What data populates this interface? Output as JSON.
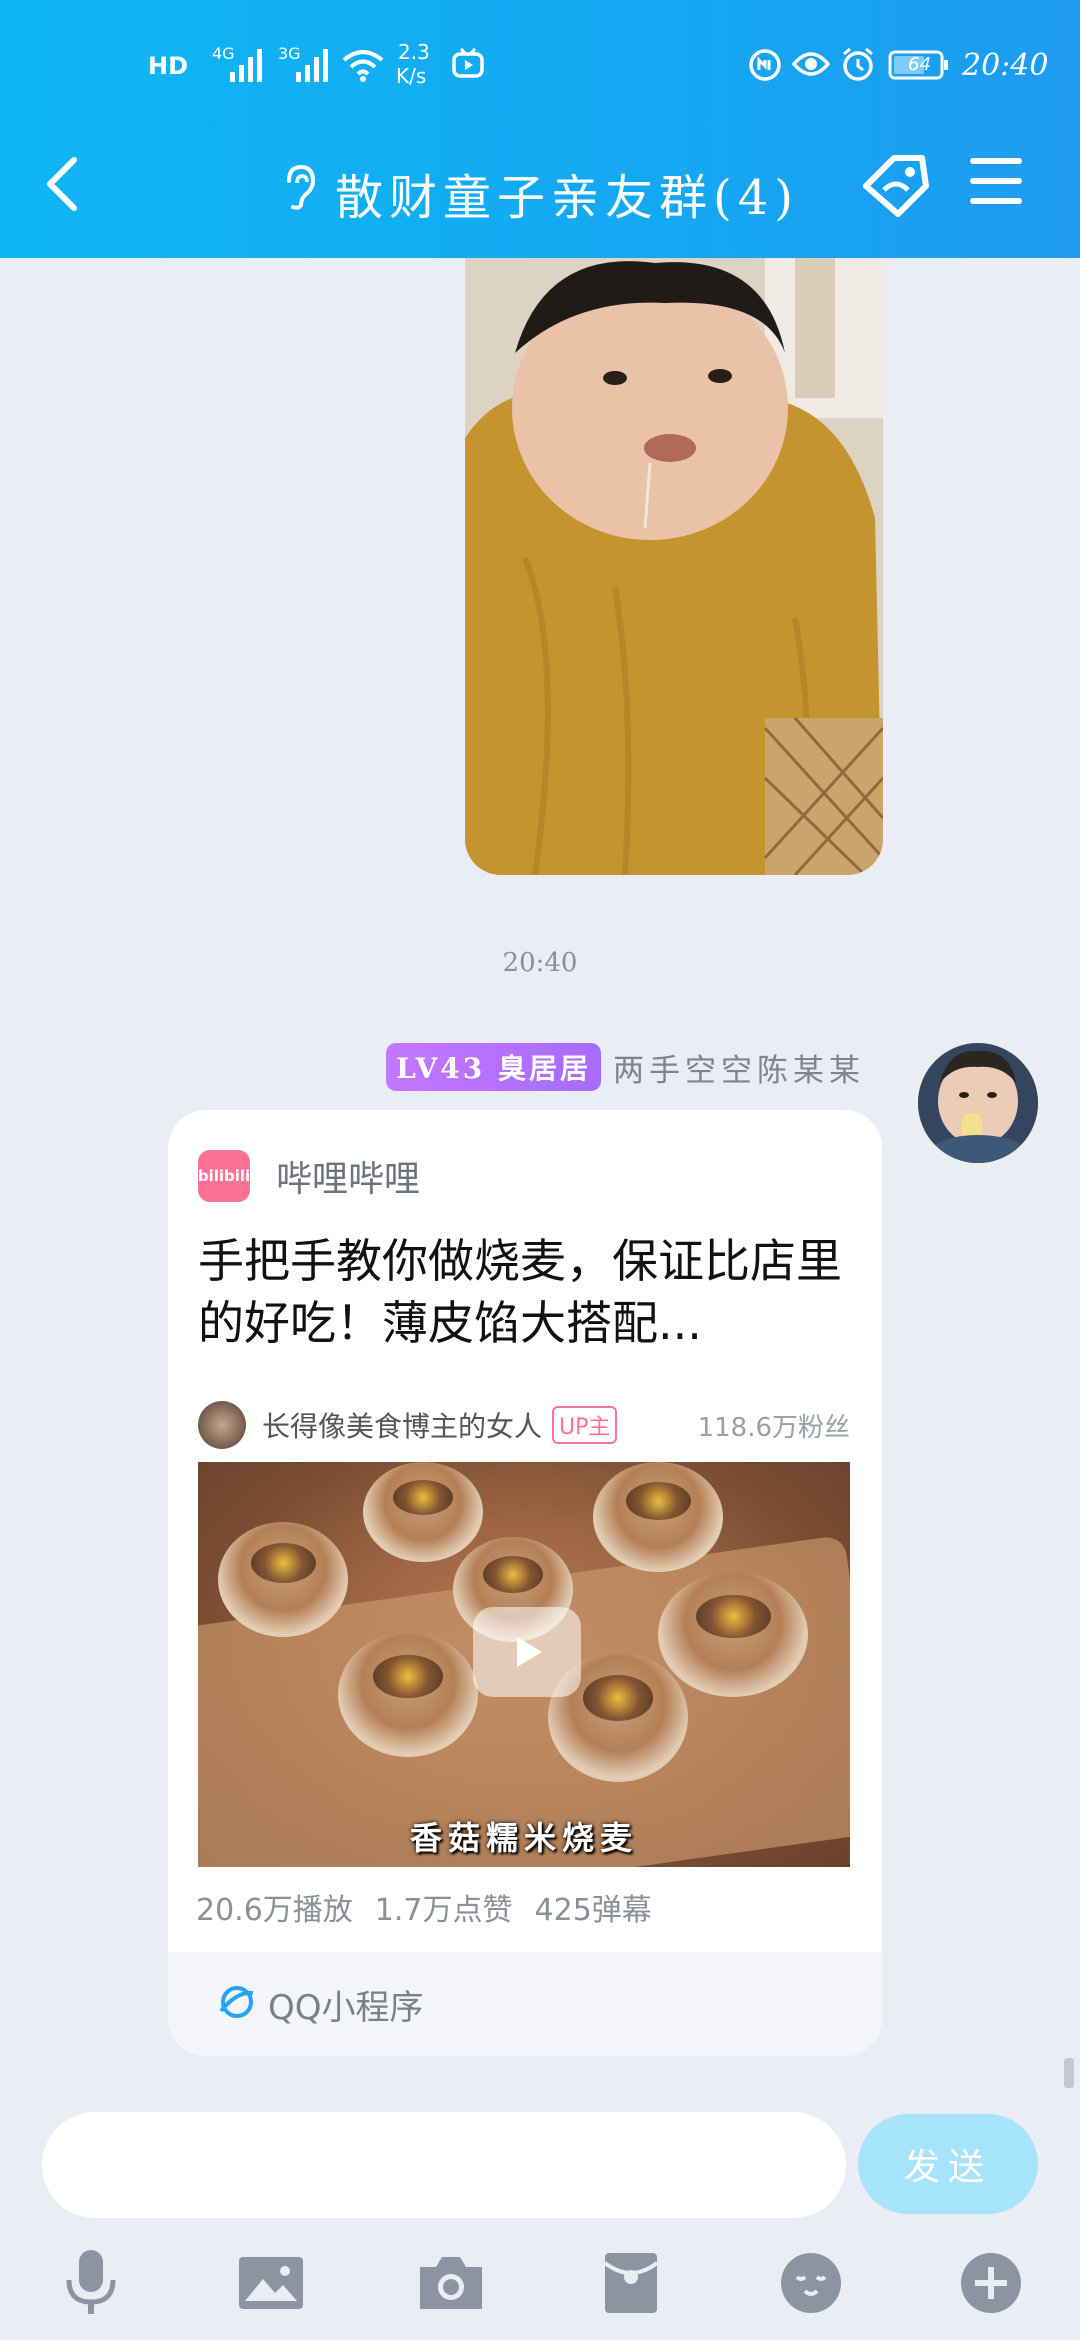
{
  "status_bar": {
    "hd": "HD",
    "net1": "4G",
    "net2": "3G",
    "speed_value": "2.3",
    "speed_unit": "K/s",
    "battery": "64",
    "time": "20:40"
  },
  "header": {
    "title": "散财童子亲友群(4)"
  },
  "messages": {
    "time_divider": "20:40",
    "sender": {
      "level": "LV43",
      "title_badge": "臭居居",
      "name": "两手空空陈某某"
    },
    "card": {
      "app_icon_text": "bilibili",
      "app_name": "哔哩哔哩",
      "video_title": "手把手教你做烧麦，保证比店里的好吃！薄皮馅大搭配...",
      "uploader_name": "长得像美食博主的女人",
      "uploader_badge": "UP主",
      "fans": "118.6万粉丝",
      "thumbnail_caption": "香菇糯米烧麦",
      "stats": [
        "20.6万播放",
        "1.7万点赞",
        "425弹幕"
      ],
      "footer_label": "QQ小程序"
    }
  },
  "input_bar": {
    "placeholder": "",
    "send_label": "发送"
  },
  "toolbar": {
    "icons": [
      "mic-icon",
      "image-icon",
      "camera-icon",
      "red-packet-icon",
      "emoji-icon",
      "plus-icon"
    ]
  },
  "colors": {
    "header_start": "#0fb6f5",
    "header_end": "#1e9bf0",
    "background": "#eaedf4",
    "bilibili_pink": "#fb7299",
    "level_purple": "#b070ff",
    "send_button": "#a6e4fb"
  }
}
